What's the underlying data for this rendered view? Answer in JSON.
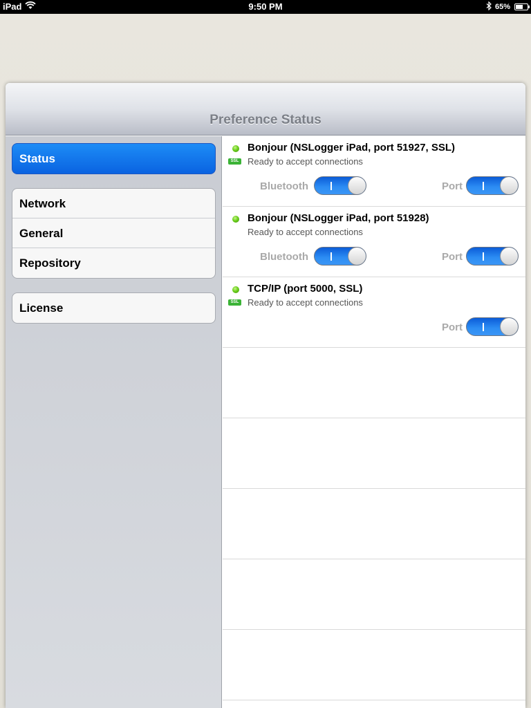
{
  "statusbar": {
    "device": "iPad",
    "time": "9:50 PM",
    "battery": "65%",
    "battery_level": 0.65,
    "icons": [
      "wifi-icon",
      "bluetooth-icon",
      "battery-icon"
    ]
  },
  "navbar": {
    "title": "Preference Status"
  },
  "sidebar": {
    "groups": [
      {
        "items": [
          {
            "label": "Status",
            "selected": true
          }
        ]
      },
      {
        "items": [
          {
            "label": "Network"
          },
          {
            "label": "General"
          },
          {
            "label": "Repository"
          }
        ]
      },
      {
        "items": [
          {
            "label": "License"
          }
        ]
      }
    ]
  },
  "status_rows": [
    {
      "title": "Bonjour (NSLogger iPad, port 51927, SSL)",
      "subtitle": "Ready to accept connections",
      "ssl_badge": "SSL",
      "bluetooth_label": "Bluetooth",
      "bluetooth_on": true,
      "port_label": "Port",
      "port_on": true
    },
    {
      "title": "Bonjour (NSLogger iPad, port 51928)",
      "subtitle": "Ready to accept connections",
      "bluetooth_label": "Bluetooth",
      "bluetooth_on": true,
      "port_label": "Port",
      "port_on": true
    },
    {
      "title": "TCP/IP (port 5000, SSL)",
      "subtitle": "Ready to accept connections",
      "ssl_badge": "SSL",
      "port_label": "Port",
      "port_on": true
    }
  ],
  "colors": {
    "selected_item": "#0a63e1",
    "status_dot": "#6bd01c",
    "ssl_badge": "#3bb336",
    "toggle_on": "#2d8ef4"
  }
}
